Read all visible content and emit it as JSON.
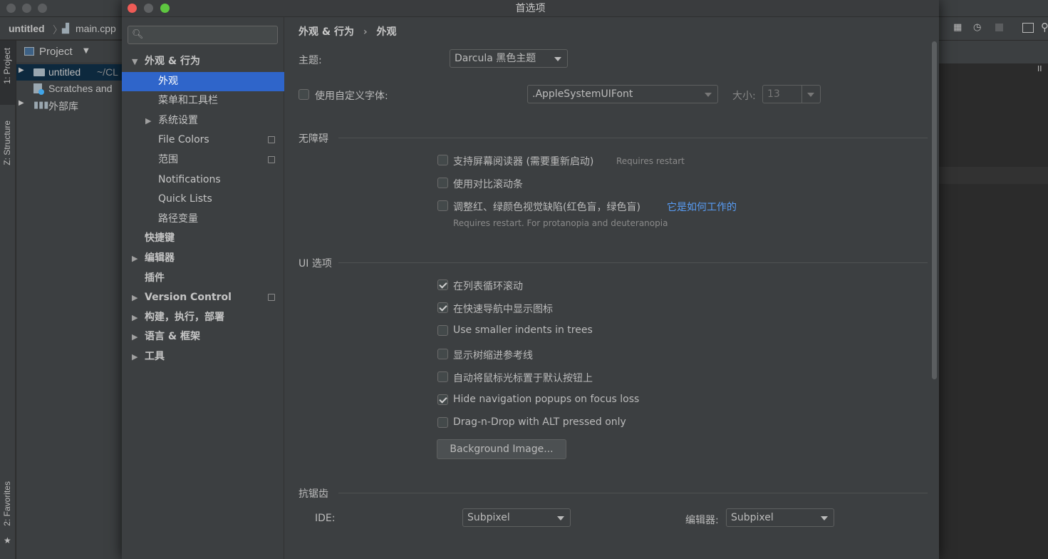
{
  "ide": {
    "crumb_project": "untitled",
    "crumb_file": "main.cpp",
    "left_tabs": [
      "1: Project",
      "Z: Structure",
      "2: Favorites"
    ],
    "panel_title": "Project",
    "tree": [
      {
        "label": "untitled",
        "suffix": "~/CL"
      },
      {
        "label": "Scratches and"
      },
      {
        "label": "外部库"
      }
    ]
  },
  "dialog": {
    "title": "首选项",
    "search": {
      "placeholder": ""
    },
    "sidebar": [
      {
        "label": "外观 & 行为",
        "level": 0,
        "expanded": true,
        "bold": true
      },
      {
        "label": "外观",
        "level": 1,
        "active": true
      },
      {
        "label": "菜单和工具栏",
        "level": 1
      },
      {
        "label": "系统设置",
        "level": 1,
        "collapsed": true
      },
      {
        "label": "File Colors",
        "level": 1,
        "copy": true
      },
      {
        "label": "范围",
        "level": 1,
        "copy": true
      },
      {
        "label": "Notifications",
        "level": 1
      },
      {
        "label": "Quick Lists",
        "level": 1
      },
      {
        "label": "路径变量",
        "level": 1
      },
      {
        "label": "快捷键",
        "level": 0,
        "bold": true
      },
      {
        "label": "编辑器",
        "level": 0,
        "collapsed": true,
        "bold": true
      },
      {
        "label": "插件",
        "level": 0,
        "bold": true
      },
      {
        "label": "Version Control",
        "level": 0,
        "collapsed": true,
        "bold": true,
        "copy": true
      },
      {
        "label": "构建，执行，部署",
        "level": 0,
        "collapsed": true,
        "bold": true
      },
      {
        "label": "语言 & 框架",
        "level": 0,
        "collapsed": true,
        "bold": true
      },
      {
        "label": "工具",
        "level": 0,
        "collapsed": true,
        "bold": true
      }
    ],
    "breadcrumb": {
      "parent": "外观 & 行为",
      "sep": "›",
      "current": "外观"
    },
    "theme": {
      "label": "主题:",
      "value": "Darcula 黑色主题"
    },
    "custom_font": {
      "label": "使用自定义字体:",
      "checked": false,
      "font": ".AppleSystemUIFont",
      "size_label": "大小:",
      "size": "13"
    },
    "accessibility": {
      "title": "无障碍",
      "screen_reader": {
        "label": "支持屏幕阅读器 (需要重新启动)",
        "hint": "Requires restart",
        "checked": false
      },
      "contrast": {
        "label": "使用对比滚动条",
        "checked": false
      },
      "color_deficiency": {
        "label": "调整红、绿颜色视觉缺陷(红色盲，绿色盲)",
        "link": "它是如何工作的",
        "hint": "Requires restart. For protanopia and deuteranopia",
        "checked": false
      }
    },
    "ui_options": {
      "title": "UI 选项",
      "items": [
        {
          "label": "在列表循环滚动",
          "checked": true
        },
        {
          "label": "在快速导航中显示图标",
          "checked": true
        },
        {
          "label": "Use smaller indents in trees",
          "checked": false
        },
        {
          "label": "显示树缩进参考线",
          "checked": false
        },
        {
          "label": "自动将鼠标光标置于默认按钮上",
          "checked": false
        },
        {
          "label": "Hide navigation popups on focus loss",
          "checked": true
        },
        {
          "label": "Drag-n-Drop with ALT pressed only",
          "checked": false
        }
      ],
      "bg_button": "Background Image..."
    },
    "antialiasing": {
      "title": "抗锯齿",
      "ide_label": "IDE:",
      "ide_value": "Subpixel",
      "editor_label": "编辑器:",
      "editor_value": "Subpixel"
    }
  }
}
